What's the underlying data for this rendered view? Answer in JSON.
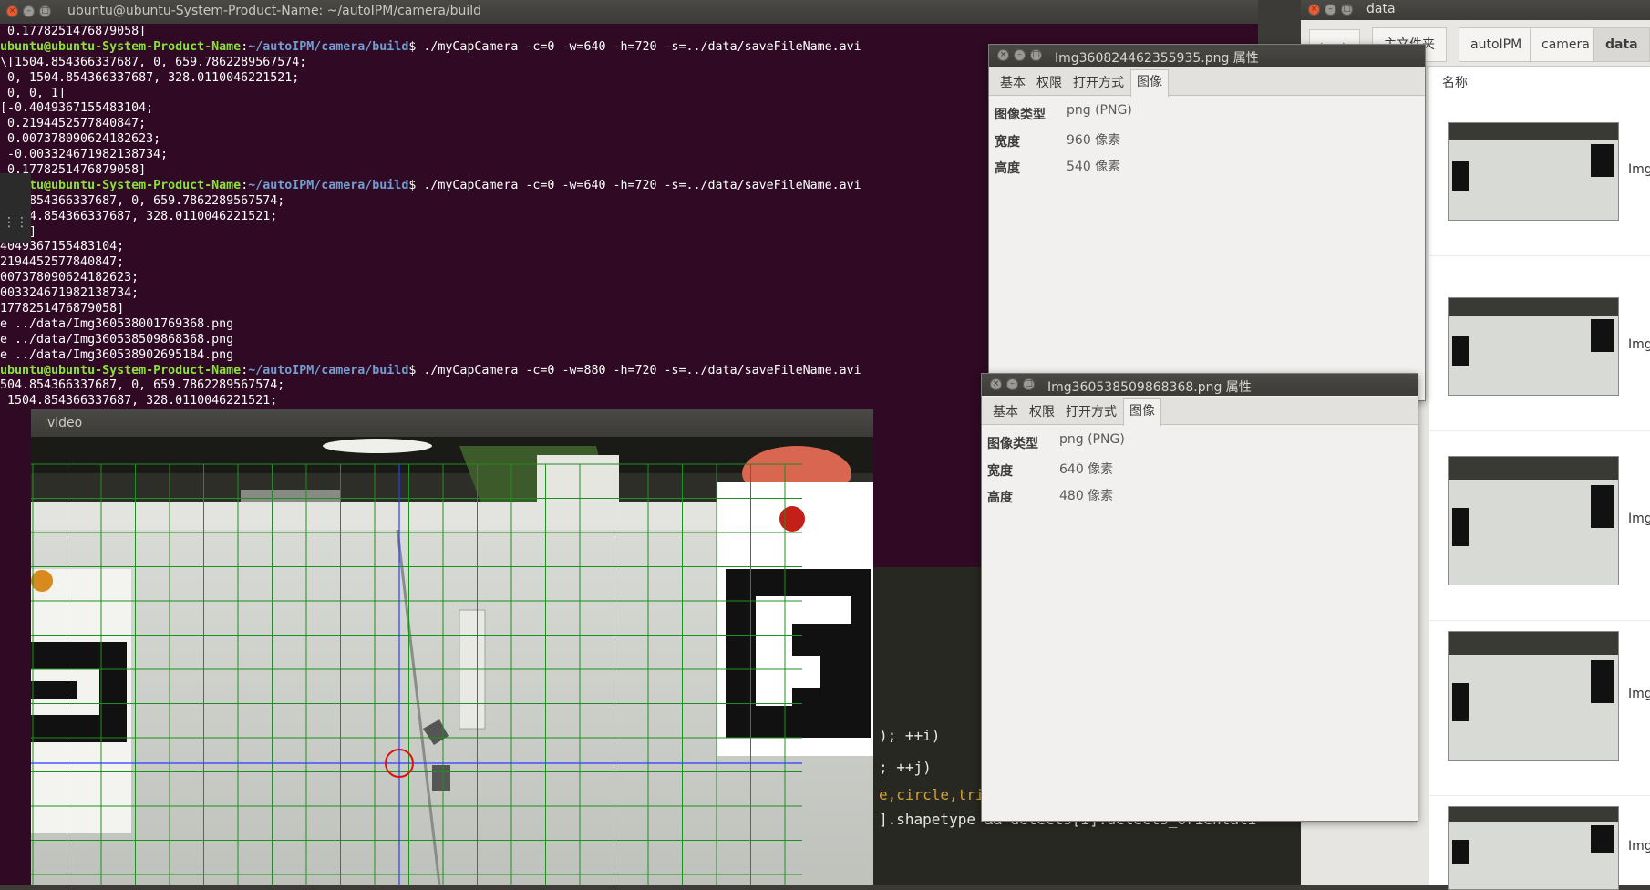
{
  "terminal": {
    "title": "ubuntu@ubuntu-System-Product-Name: ~/autoIPM/camera/build",
    "lines": [
      {
        "user": "",
        "path": "",
        "text": " 0.1778251476879058]"
      },
      {
        "user": "ubuntu@ubuntu-System-Product-Name",
        "path": "~/autoIPM/camera/build",
        "text": "$ ./myCapCamera -c=0 -w=640 -h=720 -s=../data/saveFileName.avi"
      },
      {
        "user": "",
        "path": "",
        "text": "\\[1504.854366337687, 0, 659.7862289567574;"
      },
      {
        "user": "",
        "path": "",
        "text": " 0, 1504.854366337687, 328.0110046221521;"
      },
      {
        "user": "",
        "path": "",
        "text": " 0, 0, 1]"
      },
      {
        "user": "",
        "path": "",
        "text": "[-0.4049367155483104;"
      },
      {
        "user": "",
        "path": "",
        "text": " 0.2194452577840847;"
      },
      {
        "user": "",
        "path": "",
        "text": " 0.007378090624182623;"
      },
      {
        "user": "",
        "path": "",
        "text": " -0.003324671982138734;"
      },
      {
        "user": "",
        "path": "",
        "text": " 0.1778251476879058]"
      },
      {
        "user": "ubuntu@ubuntu-System-Product-Name",
        "path": "~/autoIPM/camera/build",
        "text": "$ ./myCapCamera -c=0 -w=640 -h=720 -s=../data/saveFileName.avi"
      },
      {
        "user": "",
        "path": "",
        "text": "504.854366337687, 0, 659.7862289567574;"
      },
      {
        "user": "",
        "path": "",
        "text": " 1504.854366337687, 328.0110046221521;"
      },
      {
        "user": "",
        "path": "",
        "text": "0, 1]"
      },
      {
        "user": "",
        "path": "",
        "text": "4049367155483104;"
      },
      {
        "user": "",
        "path": "",
        "text": "2194452577840847;"
      },
      {
        "user": "",
        "path": "",
        "text": "007378090624182623;"
      },
      {
        "user": "",
        "path": "",
        "text": "003324671982138734;"
      },
      {
        "user": "",
        "path": "",
        "text": "1778251476879058]"
      },
      {
        "user": "",
        "path": "",
        "text": "e ../data/Img360538001769368.png"
      },
      {
        "user": "",
        "path": "",
        "text": "e ../data/Img360538509868368.png"
      },
      {
        "user": "",
        "path": "",
        "text": "e ../data/Img360538902695184.png"
      },
      {
        "user": "ubuntu@ubuntu-System-Product-Name",
        "path": "~/autoIPM/camera/build",
        "text": "$ ./myCapCamera -c=0 -w=880 -h=720 -s=../data/saveFileName.avi"
      },
      {
        "user": "",
        "path": "",
        "text": "504.854366337687, 0, 659.7862289567574;"
      },
      {
        "user": "",
        "path": "",
        "text": " 1504.854366337687, 328.0110046221521;"
      }
    ]
  },
  "editor": {
    "lines": [
      {
        "text": "); ++i)",
        "color": "#e8e8e2"
      },
      {
        "text": "; ++j)",
        "color": "#e8e8e2"
      },
      {
        "text": "e,circle,triangle,reversetriangle",
        "color": "#d6a031"
      },
      {
        "text": "].shapetype && detects[i].detects_orientati",
        "color": "#e8e8e2"
      }
    ]
  },
  "video": {
    "title": "video"
  },
  "dialog1": {
    "title": "Img360824462355935.png 属性",
    "tabs": [
      "基本",
      "权限",
      "打开方式",
      "图像"
    ],
    "active_tab": "图像",
    "props": [
      {
        "label": "图像类型",
        "value": "png (PNG)"
      },
      {
        "label": "宽度",
        "value": "960 像素"
      },
      {
        "label": "高度",
        "value": "540 像素"
      }
    ]
  },
  "dialog2": {
    "title": "Img360538509868368.png 属性",
    "tabs": [
      "基本",
      "权限",
      "打开方式",
      "图像"
    ],
    "active_tab": "图像",
    "props": [
      {
        "label": "图像类型",
        "value": "png (PNG)"
      },
      {
        "label": "宽度",
        "value": "640 像素"
      },
      {
        "label": "高度",
        "value": "480 像素"
      }
    ]
  },
  "files": {
    "title": "data",
    "breadcrumbs": [
      "主文件夹",
      "autoIPM",
      "camera",
      "data"
    ],
    "column_name": "名称",
    "items": [
      {
        "name": "Img"
      },
      {
        "name": "Img"
      },
      {
        "name": "Img"
      },
      {
        "name": "Img"
      },
      {
        "name": "Img"
      }
    ]
  },
  "colors": {
    "terminal_bg": "#300a24",
    "prompt_user": "#8ae234",
    "prompt_path": "#729fcf",
    "grid_green": "#1f8f1f",
    "crosshair_blue": "#2a3cff",
    "target_red": "#e01010"
  }
}
